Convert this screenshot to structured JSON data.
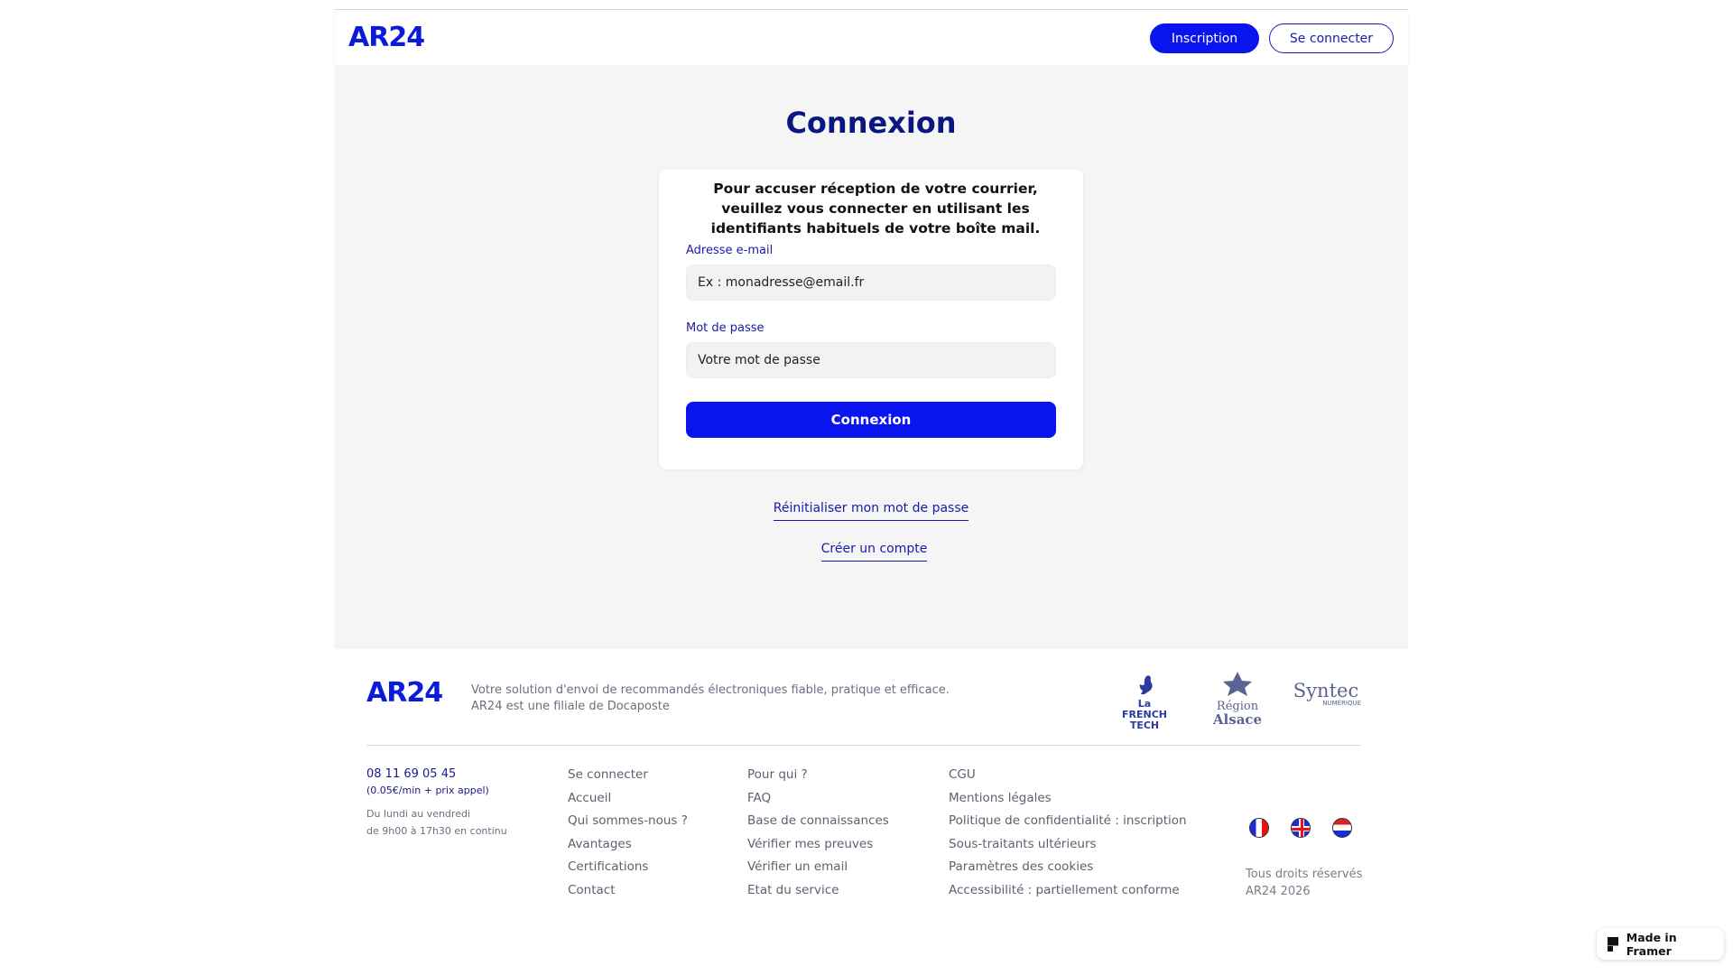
{
  "header": {
    "logo": "AR24",
    "signup_label": "Inscription",
    "login_label": "Se connecter"
  },
  "main": {
    "title": "Connexion",
    "card_text": "Pour accuser réception de votre courrier, veuillez vous connecter en utilisant les identifiants habituels de votre boîte mail.",
    "email_label": "Adresse e-mail",
    "email_placeholder": "Ex : monadresse@email.fr",
    "password_label": "Mot de passe",
    "password_placeholder": "Votre mot de passe",
    "submit_label": "Connexion",
    "reset_link": "Réinitialiser mon mot de passe",
    "create_link": "Créer un compte"
  },
  "footer": {
    "logo": "AR24",
    "tagline_1": "Votre solution d'envoi de recommandés électroniques fiable, pratique et efficace.",
    "tagline_2": "AR24 est une filiale de Docaposte",
    "partners": {
      "french_tech_1": "La",
      "french_tech_2": "FRENCH TECH",
      "region_1": "Région",
      "region_2": "Alsace",
      "syntec_1": "Syntec",
      "syntec_2": "NUMÉRIQUE"
    },
    "phone": "08 11 69 05 45",
    "price": "(0.05€/min + prix appel)",
    "hours_1": "Du lundi au vendredi",
    "hours_2": "de 9h00 à 17h30 en continu",
    "col1": [
      "Se connecter",
      "Accueil",
      "Qui sommes-nous ?",
      "Avantages",
      "Certifications",
      "Contact"
    ],
    "col2": [
      "Pour qui ?",
      "FAQ",
      "Base de connaissances",
      "Vérifier mes preuves",
      "Vérifier un email",
      "Etat du service"
    ],
    "col3": [
      "CGU",
      "Mentions légales",
      "Politique de confidentialité : inscription",
      "Sous-traitants ultérieurs",
      "Paramètres des cookies",
      "Accessibilité : partiellement conforme"
    ],
    "rights_1": "Tous droits réservés",
    "rights_2": "AR24 2026",
    "flags": [
      "flag-fr-icon",
      "flag-gb-icon",
      "flag-nl-icon"
    ]
  },
  "framer_badge": "Made in Framer"
}
